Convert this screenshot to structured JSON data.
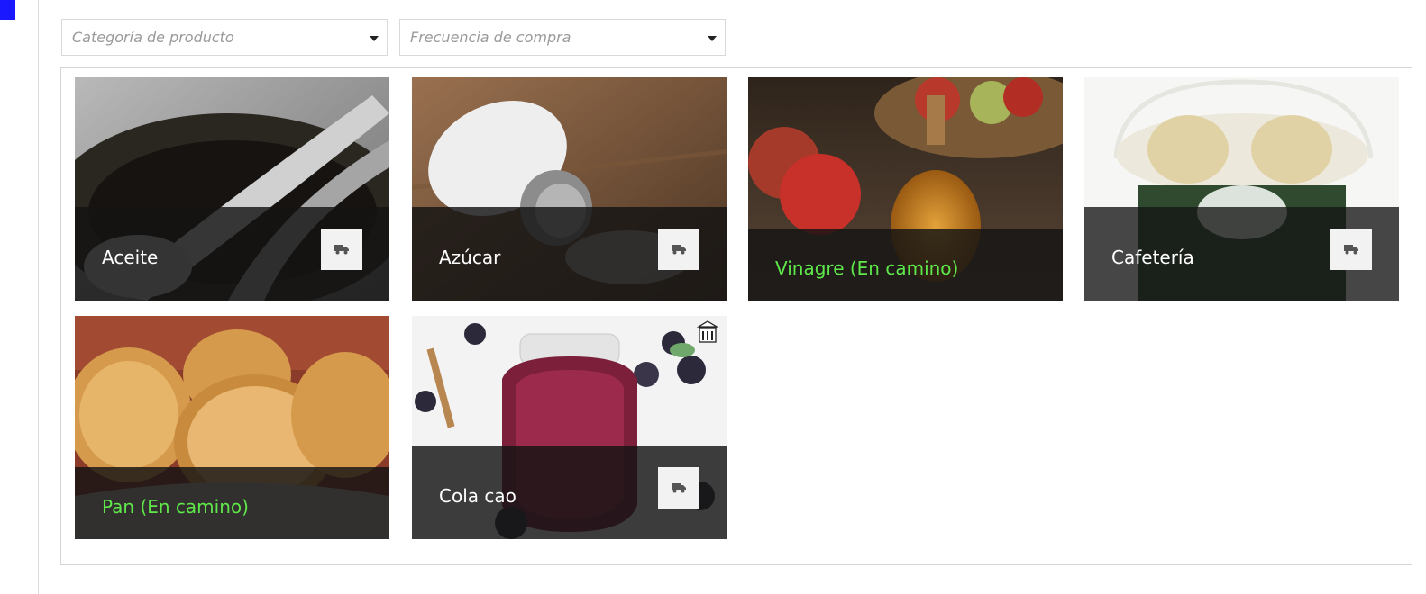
{
  "filters": {
    "category_placeholder": "Categoría de producto",
    "frequency_placeholder": "Frecuencia de compra"
  },
  "products": [
    {
      "name": "Aceite",
      "status": "available",
      "icon": "truck-icon"
    },
    {
      "name": "Azúcar",
      "status": "available",
      "icon": "truck-icon"
    },
    {
      "name": "Vinagre (En camino)",
      "status": "in-transit"
    },
    {
      "name": "Cafetería",
      "status": "available",
      "icon": "truck-icon"
    },
    {
      "name": "Pan (En camino)",
      "status": "in-transit"
    },
    {
      "name": "Cola cao",
      "status": "available",
      "icon": "truck-icon",
      "badge": "store-icon"
    }
  ],
  "colors": {
    "accent_marker": "#1a18ff",
    "in_transit_text": "#5fe84a",
    "overlay": "#141414"
  }
}
